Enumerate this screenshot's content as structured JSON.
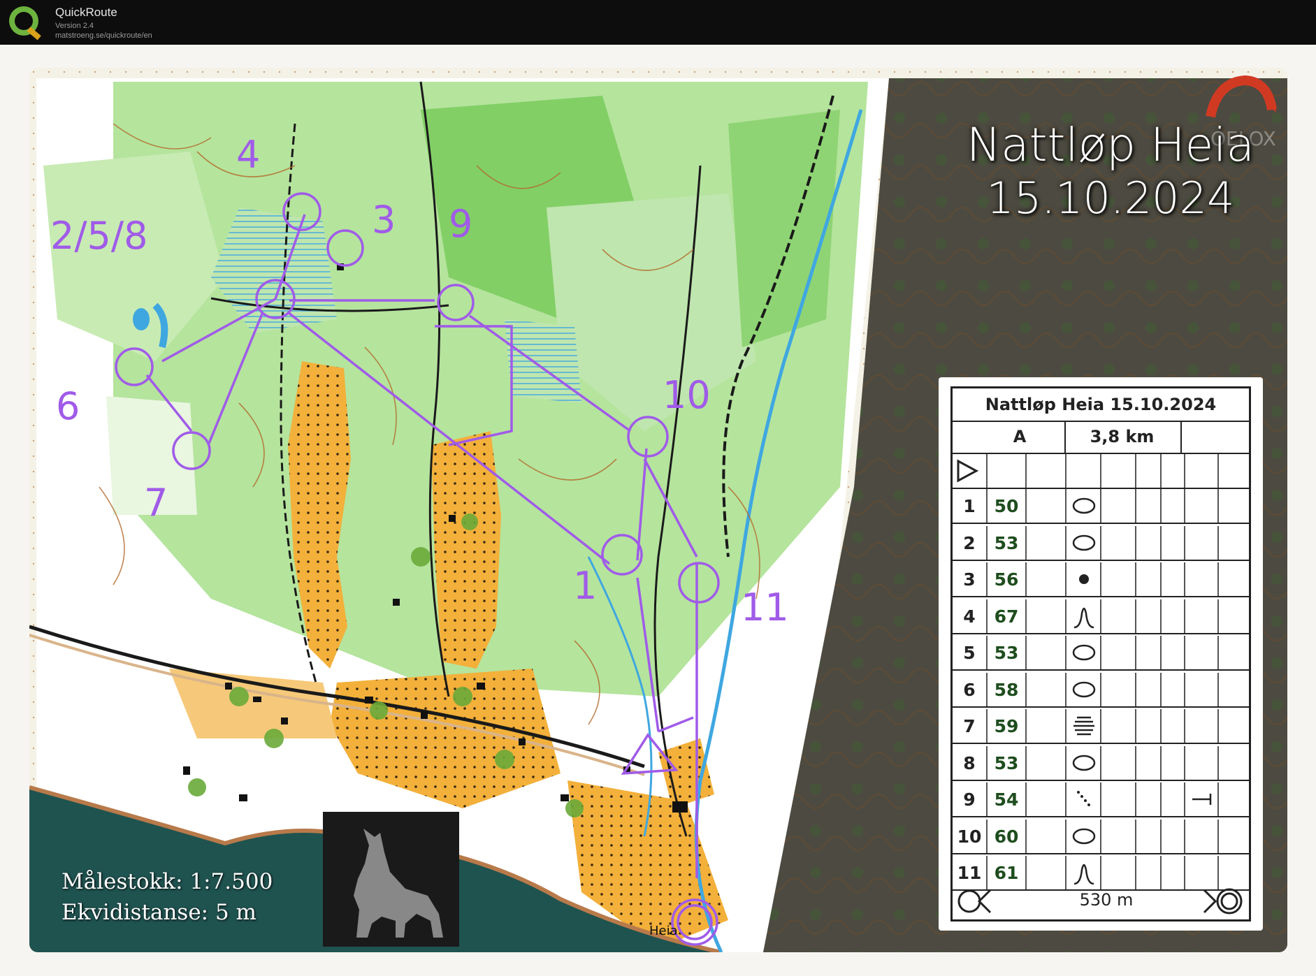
{
  "app": {
    "name": "QuickRoute",
    "version": "Version 2.4",
    "url": "matstroeng.se/quickroute/en"
  },
  "map": {
    "title_line1": "Nattløp Heia",
    "title_line2": "15.10.2024",
    "scale_text": "Målestokk: 1:7.500",
    "contour_text": "Ekvidistanse: 5 m",
    "place_name": "Heia",
    "watermark_text": "OELOX",
    "control_labels": [
      "1",
      "2/5/8",
      "3",
      "4",
      "6",
      "7",
      "9",
      "10",
      "11"
    ],
    "colors": {
      "course": "#a05be8",
      "forest_light": "#9fdc85",
      "open_yellow": "#f2b33d",
      "water": "#3fa7e0",
      "sea": "#1f5350",
      "contour": "#b26a2a"
    }
  },
  "description": {
    "title": "Nattløp Heia 15.10.2024",
    "class": "A",
    "length": "3,8 km",
    "rows": [
      {
        "num": "1",
        "code": "50",
        "symbol": "knoll-oval"
      },
      {
        "num": "2",
        "code": "53",
        "symbol": "knoll-oval"
      },
      {
        "num": "3",
        "code": "56",
        "symbol": "dot"
      },
      {
        "num": "4",
        "code": "67",
        "symbol": "boulder-bell"
      },
      {
        "num": "5",
        "code": "53",
        "symbol": "knoll-oval"
      },
      {
        "num": "6",
        "code": "58",
        "symbol": "knoll-oval"
      },
      {
        "num": "7",
        "code": "59",
        "symbol": "marsh-lines"
      },
      {
        "num": "8",
        "code": "53",
        "symbol": "knoll-oval"
      },
      {
        "num": "9",
        "code": "54",
        "symbol": "dotted-line",
        "extra": "end-bar"
      },
      {
        "num": "10",
        "code": "60",
        "symbol": "knoll-oval"
      },
      {
        "num": "11",
        "code": "61",
        "symbol": "boulder-bell"
      }
    ],
    "finish_distance": "530 m"
  }
}
